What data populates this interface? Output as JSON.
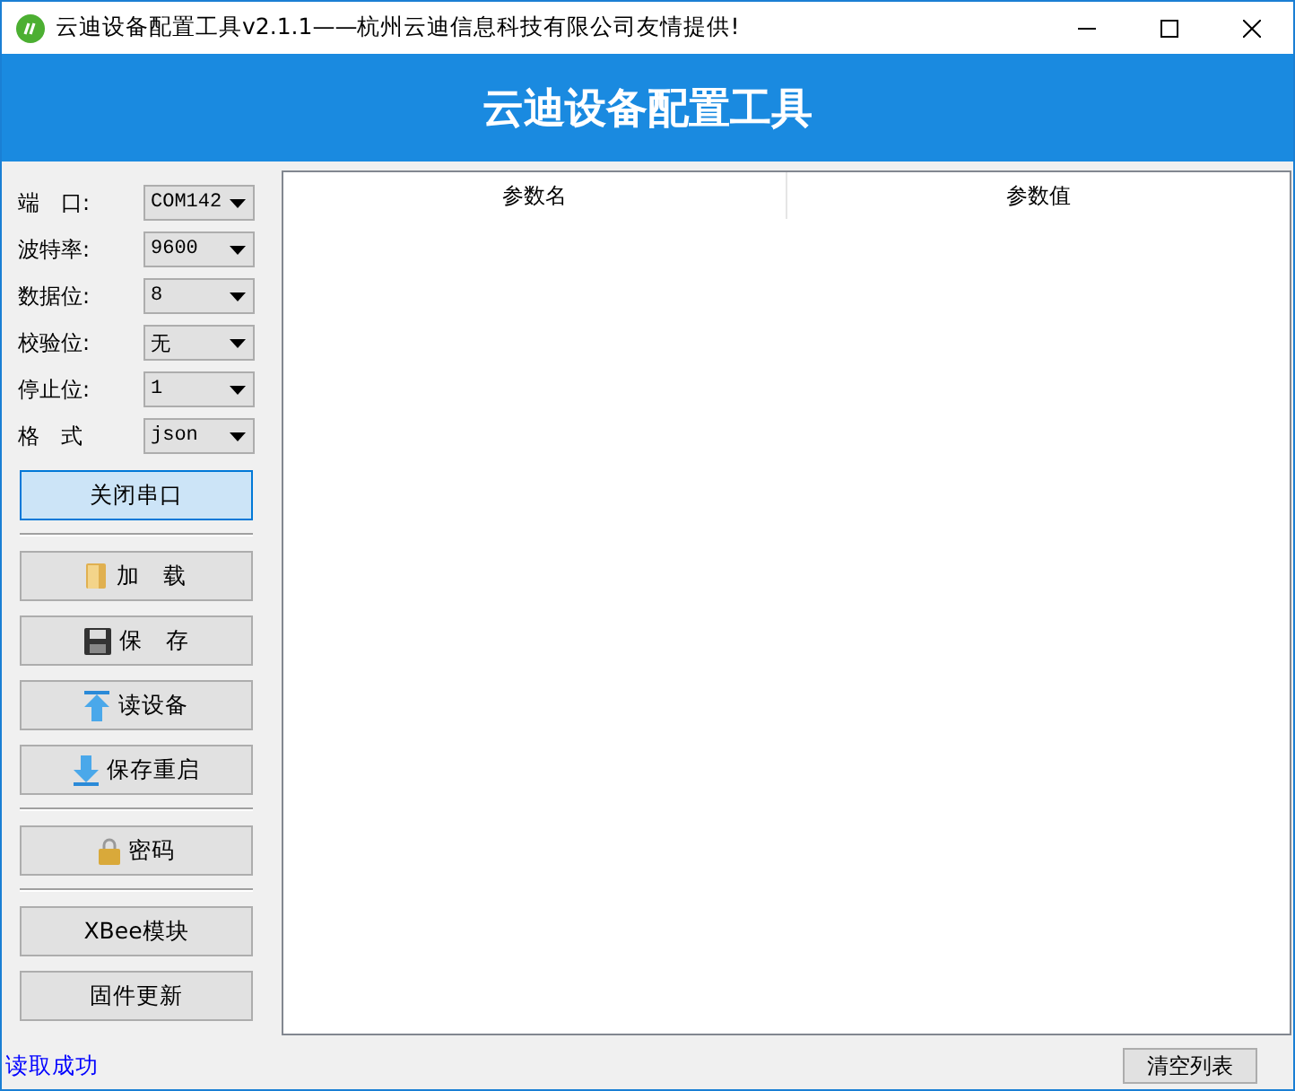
{
  "window": {
    "title": "云迪设备配置工具v2.1.1——杭州云迪信息科技有限公司友情提供!"
  },
  "header": {
    "title": "云迪设备配置工具"
  },
  "settings": [
    {
      "label": "端　口:",
      "value": "COM142"
    },
    {
      "label": "波特率:",
      "value": "9600"
    },
    {
      "label": "数据位:",
      "value": "8"
    },
    {
      "label": "校验位:",
      "value": "无"
    },
    {
      "label": "停止位:",
      "value": "1"
    },
    {
      "label": "格　式",
      "value": "json"
    }
  ],
  "port_button": {
    "label": "关闭串口",
    "selected": true
  },
  "button_groups": [
    [
      {
        "label": "加　载",
        "kind": "folder"
      },
      {
        "label": "保　存",
        "kind": "disk"
      },
      {
        "label": "读设备",
        "kind": "upload"
      },
      {
        "label": "保存重启",
        "kind": "download"
      }
    ],
    [
      {
        "label": "密码",
        "kind": "lock"
      }
    ],
    [
      {
        "label": "XBee模块",
        "kind": "plain"
      },
      {
        "label": "固件更新",
        "kind": "plain"
      }
    ]
  ],
  "table": {
    "columns": [
      "参数名",
      "参数值"
    ]
  },
  "status_bar": {
    "message": "读取成功",
    "button": "清空列表"
  }
}
